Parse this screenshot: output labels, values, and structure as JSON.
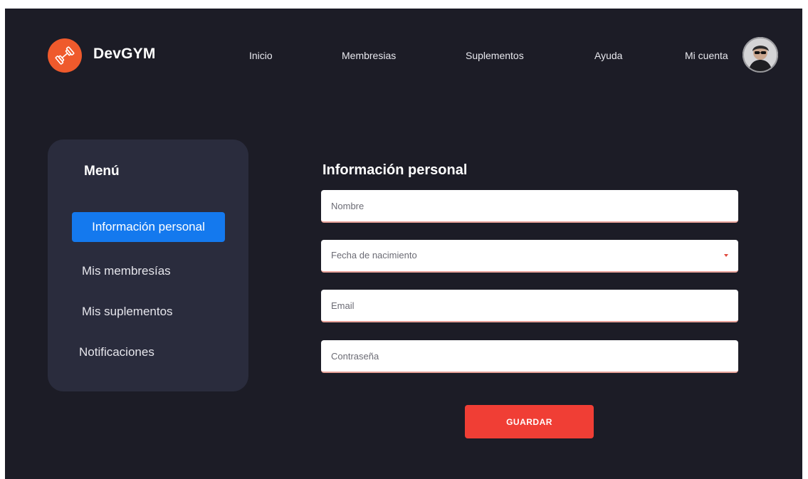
{
  "brand": {
    "name": "DevGYM",
    "logo_icon": "dumbbell-icon",
    "logo_color": "#ef5a2c"
  },
  "nav": {
    "items": [
      "Inicio",
      "Membresias",
      "Suplementos",
      "Ayuda"
    ],
    "account_label": "Mi cuenta",
    "avatar_icon": "user-avatar"
  },
  "sidebar": {
    "title": "Menú",
    "items": [
      {
        "label": "Información personal",
        "active": true
      },
      {
        "label": "Mis membresías",
        "active": false
      },
      {
        "label": "Mis suplementos",
        "active": false
      },
      {
        "label": "Notificaciones",
        "active": false
      }
    ],
    "active_color": "#1479ee"
  },
  "form": {
    "title": "Información personal",
    "fields": {
      "name_placeholder": "Nombre",
      "birthdate_label": "Fecha de nacimiento",
      "email_placeholder": "Email",
      "password_placeholder": "Contraseña"
    },
    "save_label": "GUARDAR",
    "save_color": "#f03e35"
  },
  "colors": {
    "background": "#1c1c26",
    "panel": "#2a2c3d"
  }
}
